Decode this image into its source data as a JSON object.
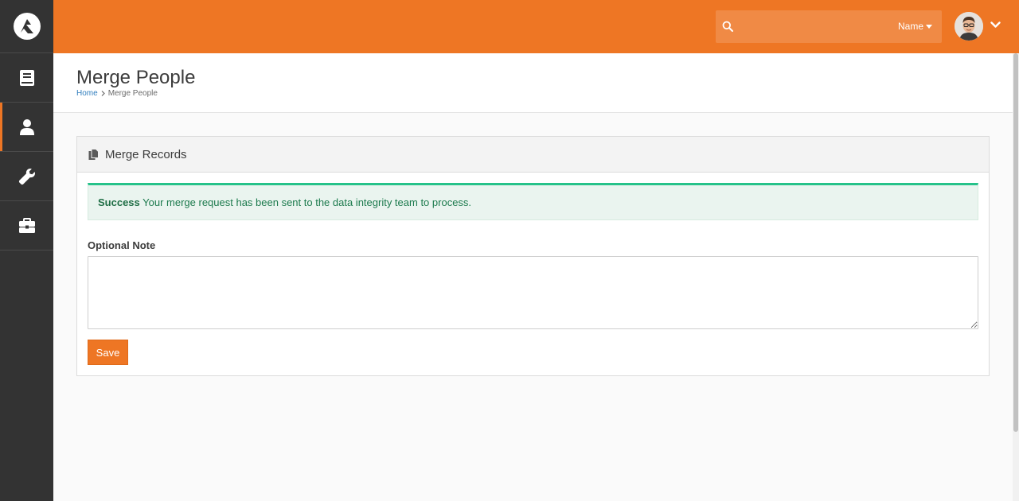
{
  "sidebar": {
    "logo_icon": "rock-logo-icon",
    "items": [
      {
        "icon": "book-icon",
        "name": "sidebar-item-content"
      },
      {
        "icon": "user-icon",
        "name": "sidebar-item-people",
        "active": true
      },
      {
        "icon": "wrench-icon",
        "name": "sidebar-item-tools"
      },
      {
        "icon": "briefcase-icon",
        "name": "sidebar-item-admin"
      }
    ]
  },
  "header": {
    "search": {
      "placeholder": "",
      "type_label": "Name"
    },
    "accent_color": "#ee7624"
  },
  "page": {
    "title": "Merge People",
    "breadcrumb": {
      "home": "Home",
      "current": "Merge People"
    }
  },
  "panel": {
    "title": "Merge Records",
    "alert": {
      "label": "Success",
      "message": "Your merge request has been sent to the data integrity team to process."
    },
    "note_label": "Optional Note",
    "note_value": "",
    "save_label": "Save"
  }
}
